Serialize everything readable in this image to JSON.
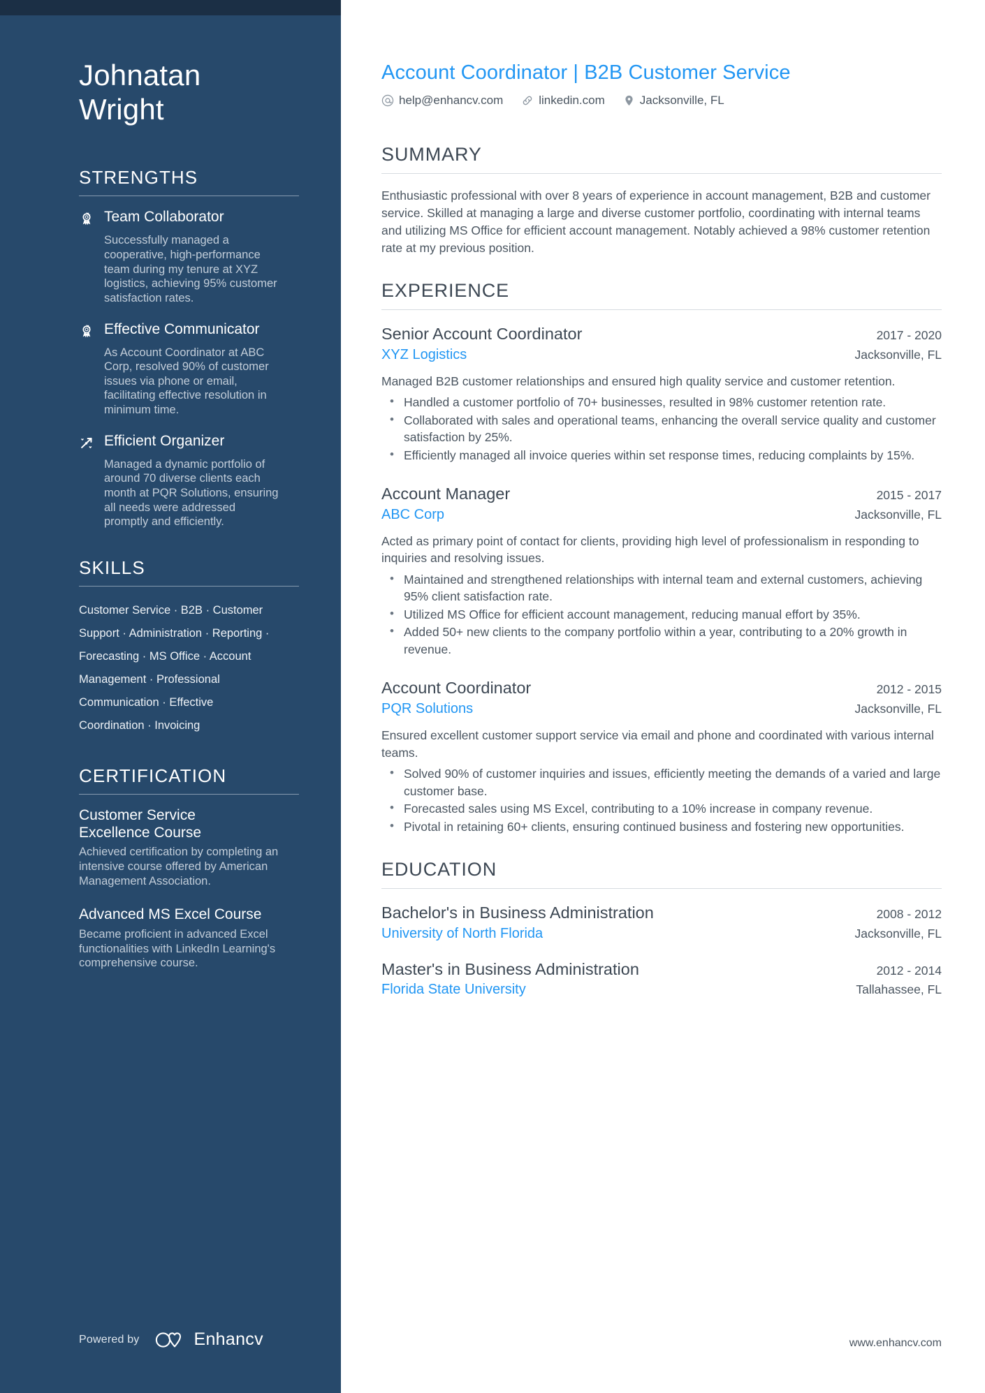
{
  "sidebar": {
    "candidate_name": "Johnatan\nWright",
    "strengths": {
      "heading": "STRENGTHS",
      "items": [
        {
          "icon": "award-ribbon-icon",
          "title": "Team Collaborator",
          "description": "Successfully managed a cooperative, high-performance team during my tenure at XYZ logistics, achieving 95% customer satisfaction rates."
        },
        {
          "icon": "award-ribbon-icon",
          "title": "Effective Communicator",
          "description": "As Account Coordinator at ABC Corp, resolved 90% of customer issues via phone or email, facilitating effective resolution in minimum time."
        },
        {
          "icon": "growth-arrow-icon",
          "title": "Efficient Organizer",
          "description": "Managed a dynamic portfolio of around 70 diverse clients each month at PQR Solutions, ensuring all needs were addressed promptly and efficiently."
        }
      ]
    },
    "skills": {
      "heading": "SKILLS",
      "items": [
        "Customer Service",
        "B2B",
        "Customer Support",
        "Administration",
        "Reporting",
        "Forecasting",
        "MS Office",
        "Account Management",
        "Professional Communication",
        "Effective Coordination",
        "Invoicing"
      ],
      "separator": "·"
    },
    "certification": {
      "heading": "CERTIFICATION",
      "items": [
        {
          "title": "Customer Service Excellence Course",
          "description": "Achieved certification by completing an intensive course offered by American Management Association."
        },
        {
          "title": "Advanced MS Excel Course",
          "description": "Became proficient in advanced Excel functionalities with LinkedIn Learning's comprehensive course."
        }
      ]
    },
    "footer": {
      "powered_by": "Powered by",
      "brand": "Enhancv"
    }
  },
  "main": {
    "job_title": "Account Coordinator | B2B Customer Service",
    "contacts": [
      {
        "icon": "at-email-icon",
        "text": "help@enhancv.com"
      },
      {
        "icon": "link-chain-icon",
        "text": "linkedin.com"
      },
      {
        "icon": "location-pin-icon",
        "text": "Jacksonville, FL"
      }
    ],
    "summary": {
      "heading": "SUMMARY",
      "text": "Enthusiastic professional with over 8 years of experience in account management, B2B and customer service. Skilled at managing a large and diverse customer portfolio, coordinating with internal teams and utilizing MS Office for efficient account management. Notably achieved a 98% customer retention rate at my previous position."
    },
    "experience": {
      "heading": "EXPERIENCE",
      "entries": [
        {
          "title": "Senior Account Coordinator",
          "dates": "2017 - 2020",
          "organization": "XYZ Logistics",
          "location": "Jacksonville, FL",
          "description": "Managed B2B customer relationships and ensured high quality service and customer retention.",
          "bullets": [
            "Handled a customer portfolio of 70+ businesses, resulted in 98% customer retention rate.",
            "Collaborated with sales and operational teams, enhancing the overall service quality and customer satisfaction by 25%.",
            "Efficiently managed all invoice queries within set response times, reducing complaints by 15%."
          ]
        },
        {
          "title": "Account Manager",
          "dates": "2015 - 2017",
          "organization": "ABC Corp",
          "location": "Jacksonville, FL",
          "description": "Acted as primary point of contact for clients, providing high level of professionalism in responding to inquiries and resolving issues.",
          "bullets": [
            "Maintained and strengthened relationships with internal team and external customers, achieving 95% client satisfaction rate.",
            "Utilized MS Office for efficient account management, reducing manual effort by 35%.",
            "Added 50+ new clients to the company portfolio within a year, contributing to a 20% growth in revenue."
          ]
        },
        {
          "title": "Account Coordinator",
          "dates": "2012 - 2015",
          "organization": "PQR Solutions",
          "location": "Jacksonville, FL",
          "description": "Ensured excellent customer support service via email and phone and coordinated with various internal teams.",
          "bullets": [
            "Solved 90% of customer inquiries and issues, efficiently meeting the demands of a varied and large customer base.",
            "Forecasted sales using MS Excel, contributing to a 10% increase in company revenue.",
            "Pivotal in retaining 60+ clients, ensuring continued business and fostering new opportunities."
          ]
        }
      ]
    },
    "education": {
      "heading": "EDUCATION",
      "entries": [
        {
          "title": "Bachelor's in Business Administration",
          "dates": "2008 - 2012",
          "organization": "University of North Florida",
          "location": "Jacksonville, FL"
        },
        {
          "title": "Master's in Business Administration",
          "dates": "2012 - 2014",
          "organization": "Florida State University",
          "location": "Tallahassee, FL"
        }
      ]
    },
    "footer_url": "www.enhancv.com"
  },
  "colors": {
    "sidebar_bg": "#27496b",
    "sidebar_topbar": "#1b2f45",
    "accent_blue": "#2196f3",
    "body_text": "#4a5560",
    "heading_text": "#3c4753"
  }
}
